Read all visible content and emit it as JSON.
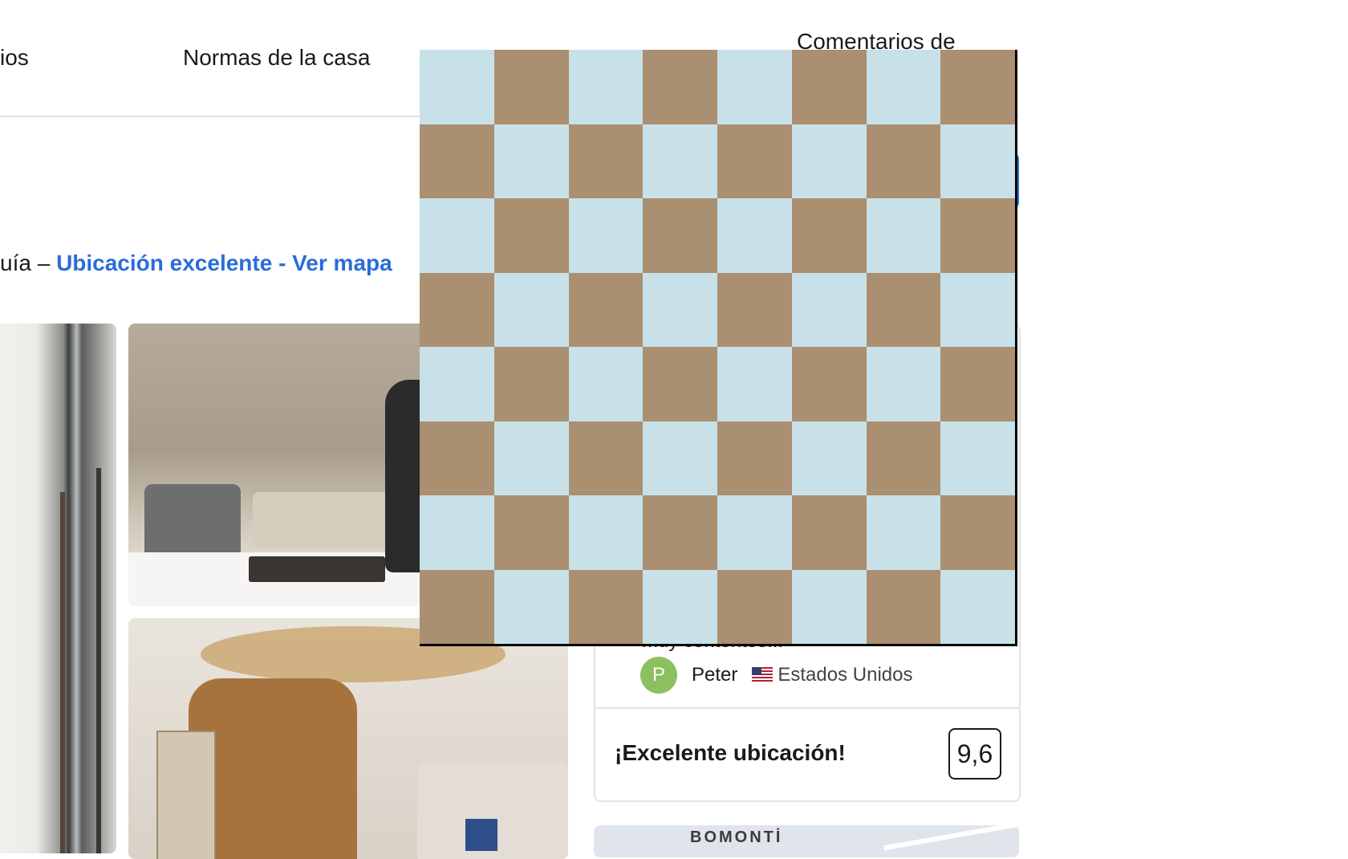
{
  "nav": {
    "tab_left_partial": "ios",
    "tab_house_rules": "Normas de la casa",
    "tab_reviews": "Comentarios de"
  },
  "location": {
    "prefix": "uía – ",
    "link": "Ubicación excelente - Ver mapa"
  },
  "review": {
    "snippet": "muy contentos...",
    "reviewer_initial": "P",
    "reviewer_name": "Peter",
    "reviewer_country": "Estados Unidos",
    "flag_icon": "us-flag-icon"
  },
  "location_score": {
    "label": "¡Excelente ubicación!",
    "score": "9,6"
  },
  "map": {
    "label": "BOMONTİ"
  },
  "colors": {
    "link_blue": "#2b6cd9",
    "avatar_green": "#8bbf5f",
    "checker_dark": "#aa8f70",
    "checker_light": "#c8e1e8"
  }
}
